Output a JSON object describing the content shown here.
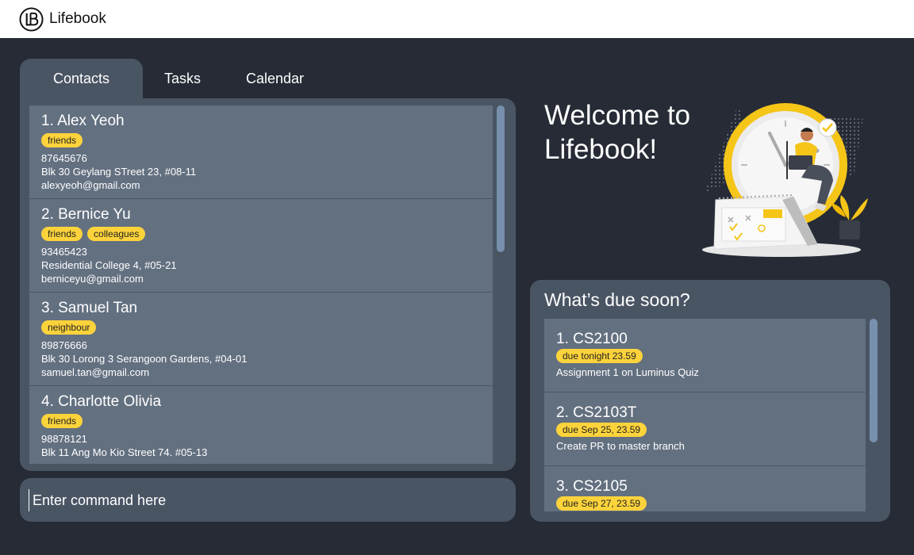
{
  "app": {
    "title": "Lifebook",
    "logo_icon": "lifebook-logo-icon"
  },
  "tabs": [
    {
      "label": "Contacts",
      "active": true
    },
    {
      "label": "Tasks",
      "active": false
    },
    {
      "label": "Calendar",
      "active": false
    }
  ],
  "contacts": [
    {
      "name": "1.  Alex Yeoh",
      "tags": [
        "friends"
      ],
      "phone": "87645676",
      "address": "Blk 30 Geylang STreet 23, #08-11",
      "email": "alexyeoh@gmail.com"
    },
    {
      "name": "2.  Bernice Yu",
      "tags": [
        "friends",
        "colleagues"
      ],
      "phone": "93465423",
      "address": "Residential College 4, #05-21",
      "email": "berniceyu@gmail.com"
    },
    {
      "name": "3.  Samuel Tan",
      "tags": [
        "neighbour"
      ],
      "phone": "89876666",
      "address": "Blk 30 Lorong 3 Serangoon Gardens, #04-01",
      "email": "samuel.tan@gmail.com"
    },
    {
      "name": "4. Charlotte Olivia",
      "tags": [
        "friends"
      ],
      "phone": "98878121",
      "address": "Blk 11 Ang Mo Kio Street 74. #05-13",
      "email": ""
    }
  ],
  "command": {
    "placeholder": "Enter command here",
    "value": ""
  },
  "welcome": {
    "line1": "Welcome to",
    "line2": "Lifebook!"
  },
  "due": {
    "title": "What’s due soon?",
    "items": [
      {
        "name": "1. CS2100",
        "tag": "due tonight 23.59",
        "description": "Assignment 1 on Luminus Quiz"
      },
      {
        "name": "2. CS2103T",
        "tag": "due Sep 25, 23.59",
        "description": "Create PR to master branch"
      },
      {
        "name": "3. CS2105",
        "tag": "due Sep 27, 23.59",
        "description": ""
      }
    ]
  },
  "colors": {
    "background": "#262b36",
    "panel": "#4a5564",
    "card": "#637080",
    "tag": "#fdd33b",
    "accent": "#f5c518"
  }
}
